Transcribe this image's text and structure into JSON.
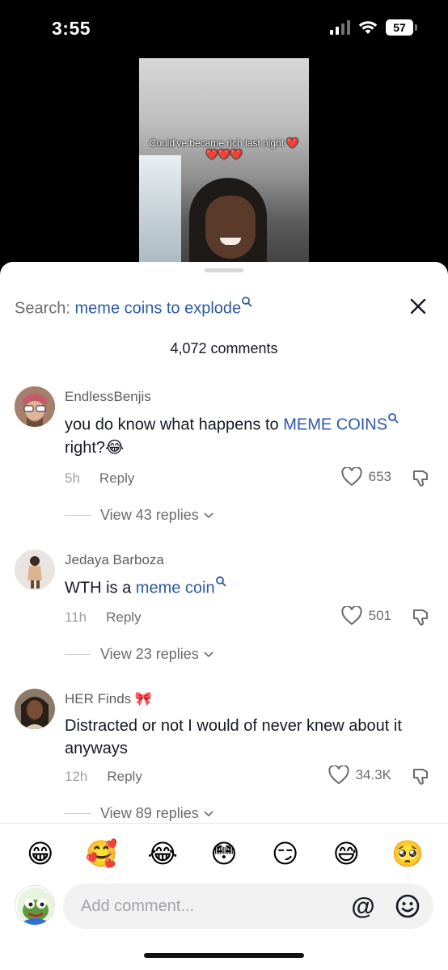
{
  "status": {
    "time": "3:55",
    "battery": "57"
  },
  "video": {
    "caption": "Could've became rich last night ❤️❤️❤️❤️"
  },
  "sheet": {
    "search_prefix": "Search:",
    "search_term": "meme coins to explode",
    "comments_count": "4,072 comments",
    "comments": [
      {
        "user": "EndlessBenjis",
        "text_before": "you do know what happens to ",
        "link": "MEME COINS",
        "text_after": "right?😂",
        "time": "5h",
        "reply": "Reply",
        "likes": "653",
        "view_replies": "View 43 replies"
      },
      {
        "user": "Jedaya Barboza",
        "text_before": "WTH is a ",
        "link": "meme coin",
        "text_after": "",
        "time": "11h",
        "reply": "Reply",
        "likes": "501",
        "view_replies": "View 23 replies"
      },
      {
        "user": "HER Finds 🎀",
        "text_before": "Distracted or not I would of never knew about it anyways",
        "link": "",
        "text_after": "",
        "time": "12h",
        "reply": "Reply",
        "likes": "34.3K",
        "view_replies": "View 89 replies"
      }
    ],
    "emojis": [
      "😁",
      "🥰",
      "😂",
      "😳",
      "😏",
      "😅",
      "🥺"
    ],
    "input_placeholder": "Add comment...",
    "at_symbol": "@"
  },
  "icons": {
    "close": "close-icon",
    "like": "heart-outline-icon",
    "dislike": "thumbs-down-icon",
    "search": "search-icon",
    "emoji_picker": "smiley-icon"
  },
  "colors": {
    "link": "#2b58a6",
    "text": "#161823",
    "muted": "#6b6b6b"
  }
}
